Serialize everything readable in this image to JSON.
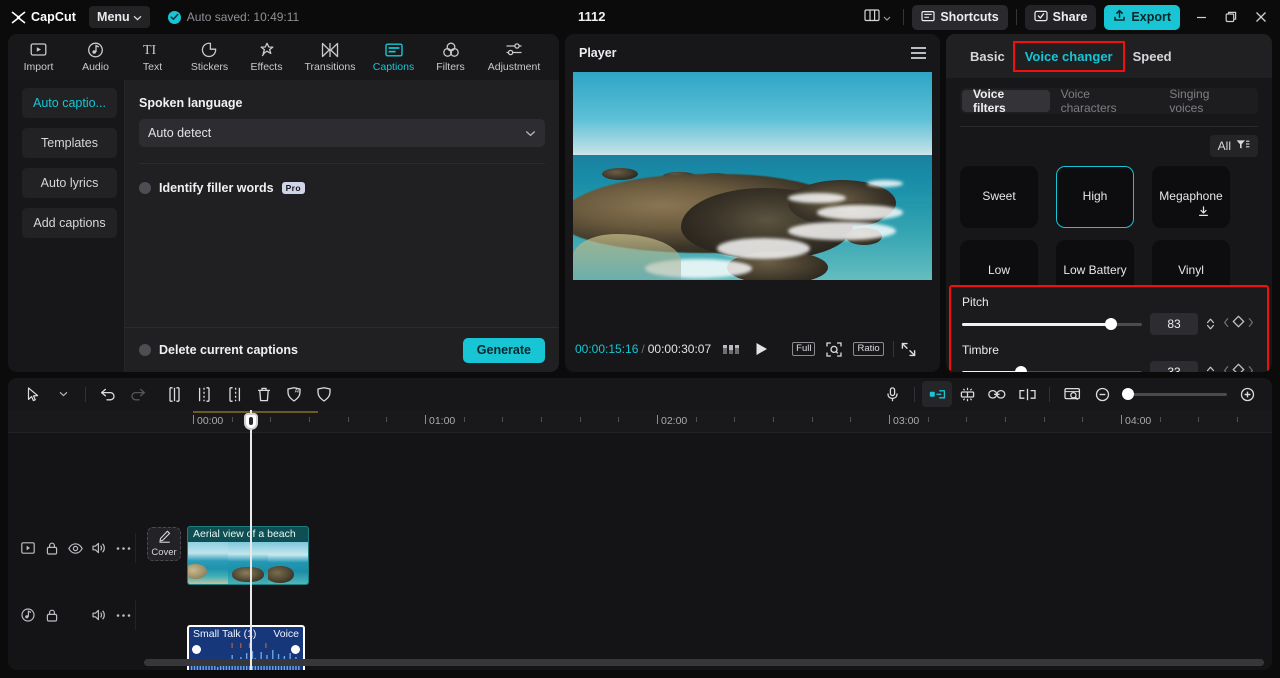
{
  "app": {
    "brand": "CapCut",
    "menu_label": "Menu",
    "autosave_text": "Auto saved: 10:49:11",
    "project_title": "1112",
    "shortcuts_label": "Shortcuts",
    "share_label": "Share",
    "export_label": "Export",
    "accent": "#17c5d4",
    "highlight": "#f50e0e",
    "window_controls": [
      "minimize",
      "maximize",
      "close"
    ]
  },
  "nav": {
    "items": [
      {
        "label": "Import",
        "icon": "import-icon",
        "active": false
      },
      {
        "label": "Audio",
        "icon": "audio-icon",
        "active": false
      },
      {
        "label": "Text",
        "icon": "text-icon",
        "active": false
      },
      {
        "label": "Stickers",
        "icon": "stickers-icon",
        "active": false
      },
      {
        "label": "Effects",
        "icon": "effects-icon",
        "active": false
      },
      {
        "label": "Transitions",
        "icon": "transitions-icon",
        "active": false
      },
      {
        "label": "Captions",
        "icon": "captions-icon",
        "active": true
      },
      {
        "label": "Filters",
        "icon": "filters-icon",
        "active": false
      },
      {
        "label": "Adjustment",
        "icon": "adjustment-icon",
        "active": false
      }
    ]
  },
  "captions_panel": {
    "side_items": [
      {
        "label": "Auto captio...",
        "active": true
      },
      {
        "label": "Templates",
        "active": false
      },
      {
        "label": "Auto lyrics",
        "active": false
      },
      {
        "label": "Add captions",
        "active": false
      }
    ],
    "spoken_language_label": "Spoken language",
    "spoken_language_value": "Auto detect",
    "identify_filler_label": "Identify filler words",
    "pro_badge": "Pro",
    "delete_captions_label": "Delete current captions",
    "generate_label": "Generate"
  },
  "player": {
    "title": "Player",
    "current_time": "00:00:15:16",
    "time_separator": "/",
    "total_time": "00:00:30:07",
    "full_label": "Full",
    "ratio_label": "Ratio",
    "icons": [
      "menu-icon",
      "quality-icon",
      "play-icon",
      "crop-icon",
      "fullscreen-icon"
    ]
  },
  "right_panel": {
    "tabs": [
      {
        "label": "Basic",
        "active": false,
        "boxed": false
      },
      {
        "label": "Voice changer",
        "active": true,
        "boxed": true
      },
      {
        "label": "Speed",
        "active": false,
        "boxed": false
      }
    ],
    "segments": [
      {
        "label": "Voice filters",
        "active": true
      },
      {
        "label": "Voice characters",
        "active": false
      },
      {
        "label": "Singing voices",
        "active": false
      }
    ],
    "filter_label": "All",
    "voice_tiles": [
      {
        "label": "Sweet",
        "selected": false,
        "downloadable": false
      },
      {
        "label": "High",
        "selected": true,
        "downloadable": false
      },
      {
        "label": "Megaphone",
        "selected": false,
        "downloadable": true
      },
      {
        "label": "Low",
        "selected": false,
        "downloadable": false
      },
      {
        "label": "Low Battery",
        "selected": false,
        "downloadable": false
      },
      {
        "label": "Vinyl",
        "selected": false,
        "downloadable": false
      }
    ],
    "sliders": [
      {
        "label": "Pitch",
        "value": "83",
        "percent": 83
      },
      {
        "label": "Timbre",
        "value": "33",
        "percent": 33
      }
    ]
  },
  "timeline": {
    "tools_left": [
      "select-icon",
      "chevron-down-icon",
      "undo-icon",
      "redo-icon",
      "split-icon",
      "trim-left-icon",
      "trim-right-icon",
      "delete-icon",
      "auto-reframe-icon",
      "stabilize-icon"
    ],
    "tools_right": [
      "microphone-icon",
      "mirror-icon",
      "adjust-icon",
      "link-icon",
      "detach-audio-icon",
      "preview-icon",
      "zoom-out-icon",
      "zoom-in-icon"
    ],
    "ruler_labels": [
      "00:00",
      "01:00",
      "02:00",
      "03:00",
      "04:00"
    ],
    "video_track": {
      "clip_title": "Aerial view of a beach",
      "cover_label": "Cover",
      "head_icons": [
        "track-video-icon",
        "lock-icon",
        "eye-icon",
        "volume-icon",
        "more-icon"
      ]
    },
    "audio_track": {
      "clip_title_left": "Small Talk (1)",
      "clip_title_right": "Voice",
      "head_icons": [
        "track-audio-icon",
        "lock-icon",
        "volume-icon",
        "more-icon"
      ]
    }
  }
}
